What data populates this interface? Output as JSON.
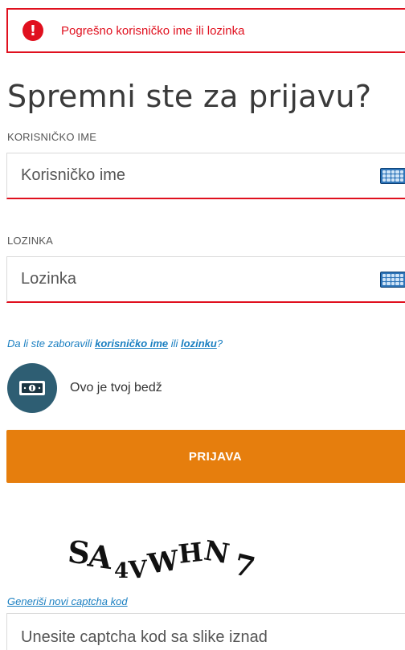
{
  "error": {
    "message": "Pogrešno korisničko ime ili lozinka",
    "icon": "exclamation-icon",
    "color": "#e0101e"
  },
  "heading": "Spremni ste za prijavu?",
  "username": {
    "label": "KORISNIČKO IME",
    "placeholder": "Korisničko ime",
    "value": ""
  },
  "password": {
    "label": "LOZINKA",
    "placeholder": "Lozinka",
    "value": ""
  },
  "forgot": {
    "prefix": "Da li ste zaboravili ",
    "username_link": "korisničko ime",
    "middle": " ili ",
    "password_link": "lozinku",
    "suffix": "?"
  },
  "badge": {
    "text": "Ovo je tvoj bedž",
    "icon": "badge-cash-icon"
  },
  "login_button": {
    "label": "PRIJAVA",
    "color": "#e67e0d"
  },
  "captcha": {
    "code": "SA4VWHN7",
    "refresh_link": "Generiši novi captcha kod",
    "placeholder": "Unesite captcha kod sa slike iznad",
    "value": ""
  }
}
